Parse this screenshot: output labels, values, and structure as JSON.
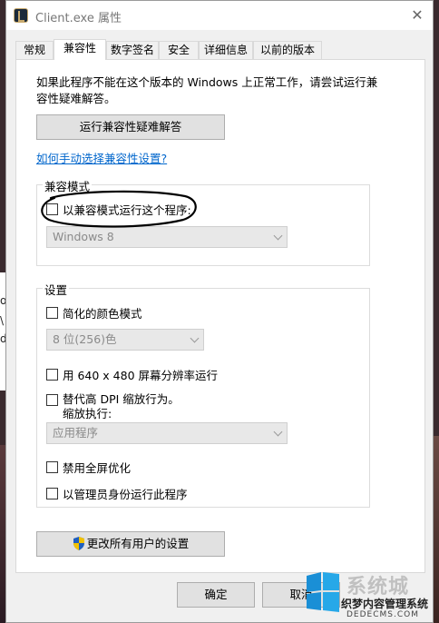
{
  "window": {
    "title": "Client.exe 属性",
    "close_glyph": "✕"
  },
  "tabs": [
    {
      "label": "常规"
    },
    {
      "label": "兼容性"
    },
    {
      "label": "数字签名"
    },
    {
      "label": "安全"
    },
    {
      "label": "详细信息"
    },
    {
      "label": "以前的版本"
    }
  ],
  "active_tab": "兼容性",
  "intro": "如果此程序不能在这个版本的 Windows 上正常工作，请尝试运行兼容性疑难解答。",
  "troubleshooter_button": "运行兼容性疑难解答",
  "manual_link": "如何手动选择兼容性设置?",
  "compat_mode": {
    "group_label": "兼容模式",
    "checkbox_label": "以兼容模式运行这个程序:",
    "checked": false,
    "os_select": "Windows 8"
  },
  "settings": {
    "group_label": "设置",
    "reduced_color": {
      "label": "简化的颜色模式",
      "checked": false
    },
    "color_select": "8 位(256)色",
    "res_640": {
      "label": "用 640 x 480 屏幕分辨率运行",
      "checked": false
    },
    "dpi_override": {
      "label_line1": "替代高 DPI 缩放行为。",
      "label_line2": "缩放执行:",
      "checked": false
    },
    "dpi_select": "应用程序",
    "disable_fullscreen": {
      "label": "禁用全屏优化",
      "checked": false
    },
    "run_as_admin": {
      "label": "以管理员身份运行此程序",
      "checked": false
    }
  },
  "all_users_button": "更改所有用户的设置",
  "footer": {
    "ok": "确定",
    "cancel": "取消"
  },
  "watermark": {
    "brand": "系统城",
    "line2": "织梦内容管理系统",
    "line3": "DEDECMS.COM"
  },
  "background_left_glyphs": [
    "o",
    "\\",
    "d"
  ],
  "colors": {
    "link": "#0066cc",
    "annotation_circle": "#000000"
  }
}
